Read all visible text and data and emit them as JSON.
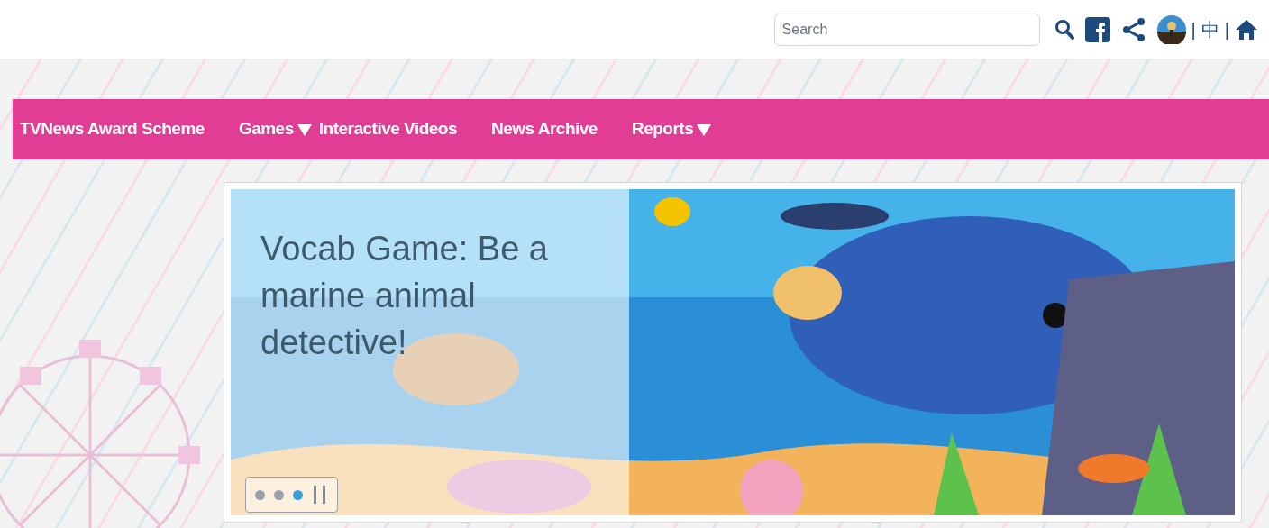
{
  "top_bar": {
    "search": {
      "placeholder": "Search"
    },
    "separators": [
      "|",
      "|"
    ],
    "language_link": "中"
  },
  "nav": [
    {
      "label": "TVNews Award Scheme",
      "dropdown": false
    },
    {
      "label": "Games",
      "dropdown": true
    },
    {
      "label": "Interactive Videos",
      "dropdown": false
    },
    {
      "label": "News Archive",
      "dropdown": false
    },
    {
      "label": "Reports",
      "dropdown": true
    }
  ],
  "carousel": {
    "caption": "Vocab Game: Be a marine animal detective!",
    "indicators": [
      {
        "selected": false
      },
      {
        "selected": false
      },
      {
        "selected": true
      }
    ]
  }
}
